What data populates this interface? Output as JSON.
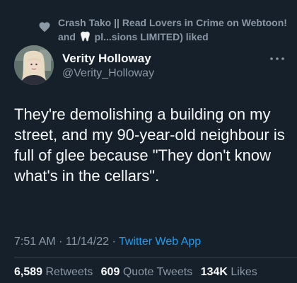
{
  "social_context": {
    "liked_text_part1": "Crash Tako || Read Lovers in Crime on Webtoon! and",
    "liked_text_part2": "pl...sions LIMITED) liked",
    "icon": "heart-icon",
    "emoji_icon": "tooth-icon"
  },
  "author": {
    "display_name": "Verity Holloway",
    "handle": "@Verity_Holloway",
    "more_icon": "more-icon"
  },
  "tweet": {
    "text": "They're demolishing a building on my street, and my 90-year-old neighbour is full of glee because \"They don't know what's in the cellars\"."
  },
  "meta": {
    "time": "7:51 AM",
    "separator": " · ",
    "date": "11/14/22",
    "source": "Twitter Web App"
  },
  "stats": {
    "retweets_count": "6,589",
    "retweets_label": "Retweets",
    "quotes_count": "609",
    "quotes_label": "Quote Tweets",
    "likes_count": "134K",
    "likes_label": "Likes"
  },
  "colors": {
    "background": "#15202b",
    "primary_text": "#f7f9f9",
    "secondary_text": "#8b98a5",
    "link": "#1d9bf0"
  }
}
